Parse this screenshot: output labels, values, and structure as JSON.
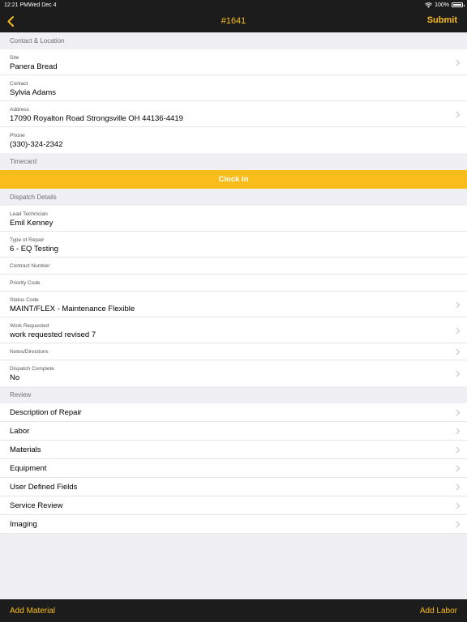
{
  "status_bar": {
    "time": "12:21 PM",
    "date": "Wed Dec 4",
    "battery": "100%"
  },
  "nav": {
    "title": "#1641",
    "submit_label": "Submit",
    "back_icon": "chevron-left-icon"
  },
  "sections": {
    "contact_location": {
      "header": "Contact & Location",
      "rows": [
        {
          "label": "Site",
          "value": "Panera Bread",
          "chevron": true
        },
        {
          "label": "Contact",
          "value": "Sylvia Adams",
          "chevron": false
        },
        {
          "label": "Address",
          "value": "17090 Royalton Road  Strongsville OH 44136-4419",
          "chevron": true
        },
        {
          "label": "Phone",
          "value": "(330)-324-2342",
          "chevron": false
        }
      ]
    },
    "timecard": {
      "header": "Timecard",
      "clock_in_label": "Clock In"
    },
    "dispatch": {
      "header": "Dispatch Details",
      "rows": [
        {
          "label": "Lead Technician",
          "value": "Emil Kenney",
          "chevron": false
        },
        {
          "label": "Type of Repair",
          "value": "6 - EQ Testing",
          "chevron": false
        },
        {
          "label": "Contract Number",
          "value": "",
          "chevron": false
        },
        {
          "label": "Priority Code",
          "value": "",
          "chevron": false
        },
        {
          "label": "Status Code",
          "value": "MAINT/FLEX - Maintenance Flexible",
          "chevron": true
        },
        {
          "label": "Work Requested",
          "value": "work requested revised 7",
          "chevron": true
        },
        {
          "label": "Notes/Directions",
          "value": "",
          "chevron": true
        },
        {
          "label": "Dispatch Complete",
          "value": "No",
          "chevron": true
        }
      ]
    },
    "review": {
      "header": "Review",
      "items": [
        "Description of Repair",
        "Labor",
        "Materials",
        "Equipment",
        "User Defined Fields",
        "Service Review",
        "Imaging"
      ]
    }
  },
  "toolbar": {
    "add_material_label": "Add Material",
    "add_labor_label": "Add Labor"
  },
  "colors": {
    "accent": "#f9bd1b",
    "bar": "#1c1c1c",
    "background": "#efeff4"
  }
}
